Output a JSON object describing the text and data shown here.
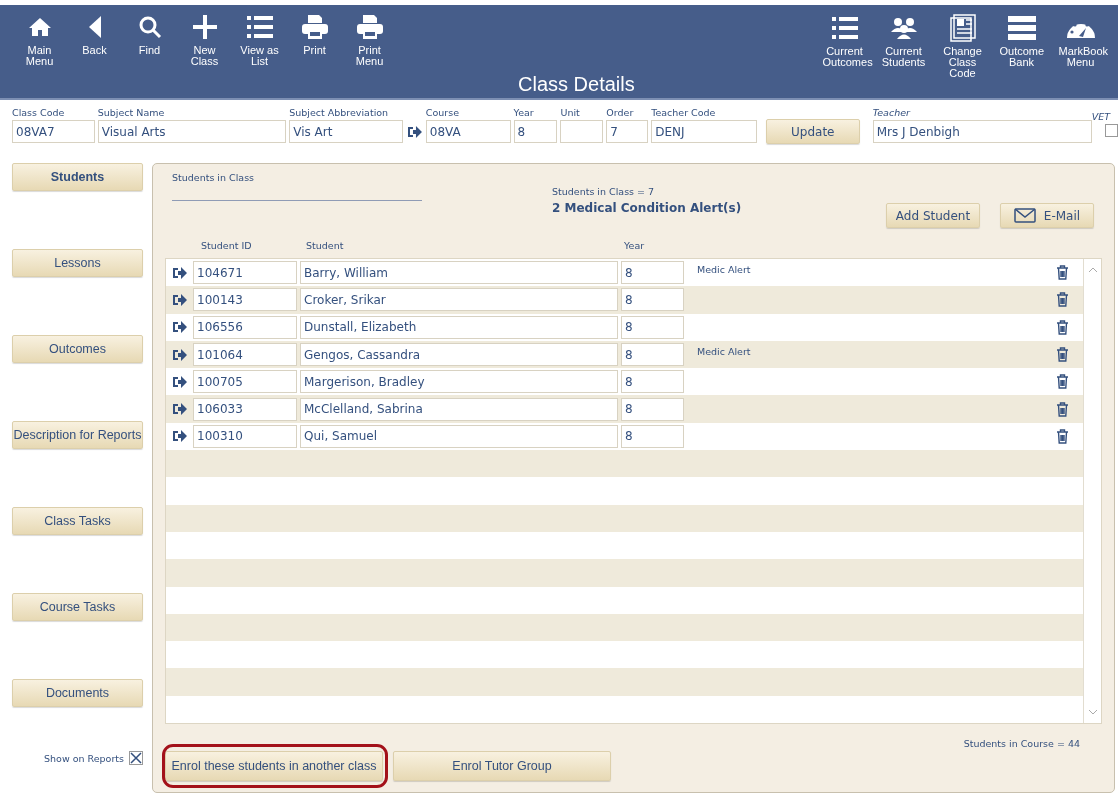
{
  "toolbar_left": [
    {
      "label": "Main Menu"
    },
    {
      "label": "Back"
    },
    {
      "label": "Find"
    },
    {
      "label": "New Class"
    },
    {
      "label": "View as List"
    },
    {
      "label": "Print"
    },
    {
      "label": "Print Menu"
    }
  ],
  "window": {
    "title": "Class Details"
  },
  "toolbar_right": [
    {
      "label": "Current Outcomes"
    },
    {
      "label": "Current Students"
    },
    {
      "label": "Change Class Code"
    },
    {
      "label": "Outcome Bank"
    },
    {
      "label": "MarkBook Menu"
    }
  ],
  "fields": [
    {
      "label": "Class Code",
      "value": "08VA7"
    },
    {
      "label": "Subject Name",
      "value": "Visual Arts"
    },
    {
      "label": "Subject Abbreviation",
      "value": "Vis Art"
    },
    {
      "label": "Course",
      "value": "08VA"
    },
    {
      "label": "Year",
      "value": "8"
    },
    {
      "label": "Unit"
    },
    {
      "label": "Order",
      "value": "7"
    },
    {
      "label": "Teacher Code",
      "value": "DENJ"
    }
  ],
  "update_button": "Update",
  "teacher": {
    "label": "Teacher",
    "value": "Mrs J Denbigh"
  },
  "vet": {
    "label": "VET",
    "checked": false
  },
  "sidebar": {
    "items": [
      {
        "label": "Students",
        "selected": true
      },
      {
        "label": "Lessons",
        "selected": false
      },
      {
        "label": "Outcomes",
        "selected": false
      },
      {
        "label": "Description for Reports",
        "selected": false
      },
      {
        "label": "Class Tasks",
        "selected": false
      },
      {
        "label": "Course Tasks",
        "selected": false
      },
      {
        "label": "Documents",
        "selected": false
      }
    ],
    "show_on_reports": {
      "label": "Show on Reports",
      "checked": true
    }
  },
  "panel": {
    "title": "Students in Class",
    "count": "Students in Class  = 7",
    "alerts": "2 Medical Condition Alert(s)",
    "add_button": "Add Student",
    "email_button": "E-Mail",
    "columns": [
      "Student ID",
      "Student",
      "Year"
    ],
    "rows": [
      {
        "id": "104671",
        "name": "Barry, William",
        "year": "8",
        "alert": "Medic Alert"
      },
      {
        "id": "100143",
        "name": "Croker, Srikar",
        "year": "8",
        "alert": ""
      },
      {
        "id": "106556",
        "name": "Dunstall, Elizabeth",
        "year": "8",
        "alert": ""
      },
      {
        "id": "101064",
        "name": "Gengos, Cassandra",
        "year": "8",
        "alert": "Medic Alert"
      },
      {
        "id": "100705",
        "name": "Margerison, Bradley",
        "year": "8",
        "alert": ""
      },
      {
        "id": "106033",
        "name": "McClelland, Sabrina",
        "year": "8",
        "alert": ""
      },
      {
        "id": "100310",
        "name": "Qui, Samuel",
        "year": "8",
        "alert": ""
      }
    ],
    "course_count": "Students in Course  = 44",
    "bottom_buttons": [
      {
        "label": "Enrol these students in another class",
        "highlighted": true
      },
      {
        "label": "Enrol Tutor Group",
        "highlighted": false
      }
    ]
  }
}
